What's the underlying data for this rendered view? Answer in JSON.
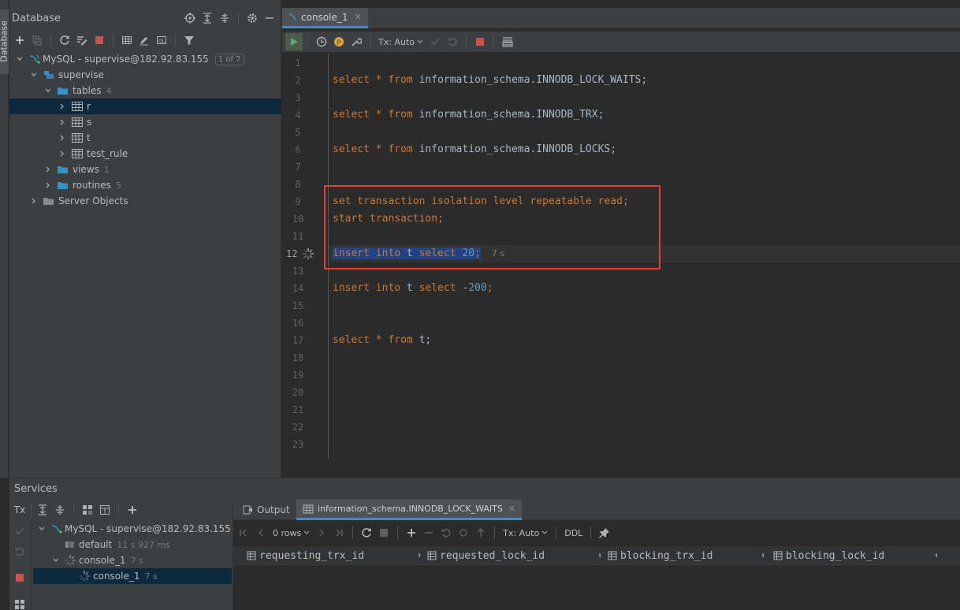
{
  "db_panel": {
    "title": "Database",
    "side_tab": "Database"
  },
  "tree": {
    "connection": {
      "label": "MySQL - supervise@182.92.83.155",
      "badge": "1 of 7"
    },
    "schema": {
      "label": "supervise"
    },
    "tables": {
      "label": "tables",
      "count": "4"
    },
    "table_items": [
      {
        "label": "r"
      },
      {
        "label": "s"
      },
      {
        "label": "t"
      },
      {
        "label": "test_rule"
      }
    ],
    "views": {
      "label": "views",
      "count": "1"
    },
    "routines": {
      "label": "routines",
      "count": "5"
    },
    "server_objects": {
      "label": "Server Objects"
    }
  },
  "editor": {
    "tab_label": "console_1",
    "tx_mode": "Tx: Auto",
    "line_numbers": [
      "1",
      "2",
      "3",
      "4",
      "5",
      "6",
      "7",
      "8",
      "9",
      "10",
      "11",
      "12",
      "13",
      "14",
      "15",
      "16",
      "17",
      "18",
      "19",
      "20",
      "21",
      "22",
      "23"
    ],
    "lines": {
      "l2": {
        "kw1": "select",
        "star": " * ",
        "kw2": "from",
        "rest": " information_schema.INNODB_LOCK_WAITS;"
      },
      "l4": {
        "kw1": "select",
        "star": " * ",
        "kw2": "from",
        "rest": " information_schema.INNODB_TRX;"
      },
      "l6": {
        "kw1": "select",
        "star": " * ",
        "kw2": "from",
        "rest": " information_schema.INNODB_LOCKS;"
      },
      "l9": {
        "kw": "set transaction isolation level repeatable read",
        "rest": ";"
      },
      "l10": {
        "kw": "start transaction",
        "rest": ";"
      },
      "l12": {
        "kw1": "insert into",
        "mid": " t ",
        "kw2": "select",
        "num": " 20",
        "rest": ";",
        "timer": "7 s"
      },
      "l14": {
        "kw1": "insert into",
        "mid": " t ",
        "kw2": "select",
        "neg": " -",
        "num": "200",
        "rest": ";"
      },
      "l17": {
        "kw1": "select",
        "star": " * ",
        "kw2": "from",
        "rest": " t;"
      }
    }
  },
  "services": {
    "title": "Services",
    "tx_label": "Tx",
    "tree": {
      "connection": {
        "label": "MySQL - supervise@182.92.83.155"
      },
      "default": {
        "label": "default",
        "meta": "11 s 927 ms"
      },
      "console_group": {
        "label": "console_1",
        "meta": "7 s"
      },
      "console_item": {
        "label": "console_1",
        "meta": "7 s"
      }
    },
    "tabs": {
      "output": "Output",
      "result": "information_schema.INNODB_LOCK_WAITS"
    },
    "result_toolbar": {
      "rows": "0 rows",
      "tx_mode": "Tx: Auto",
      "ddl": "DDL"
    },
    "columns": [
      "requesting_trx_id",
      "requested_lock_id",
      "blocking_trx_id",
      "blocking_lock_id"
    ]
  },
  "colors": {
    "accent_blue": "#3592c4",
    "keyword": "#cc7832",
    "number": "#6897bb",
    "highlight_box": "#e0403a",
    "selected_row": "#0d293e"
  }
}
